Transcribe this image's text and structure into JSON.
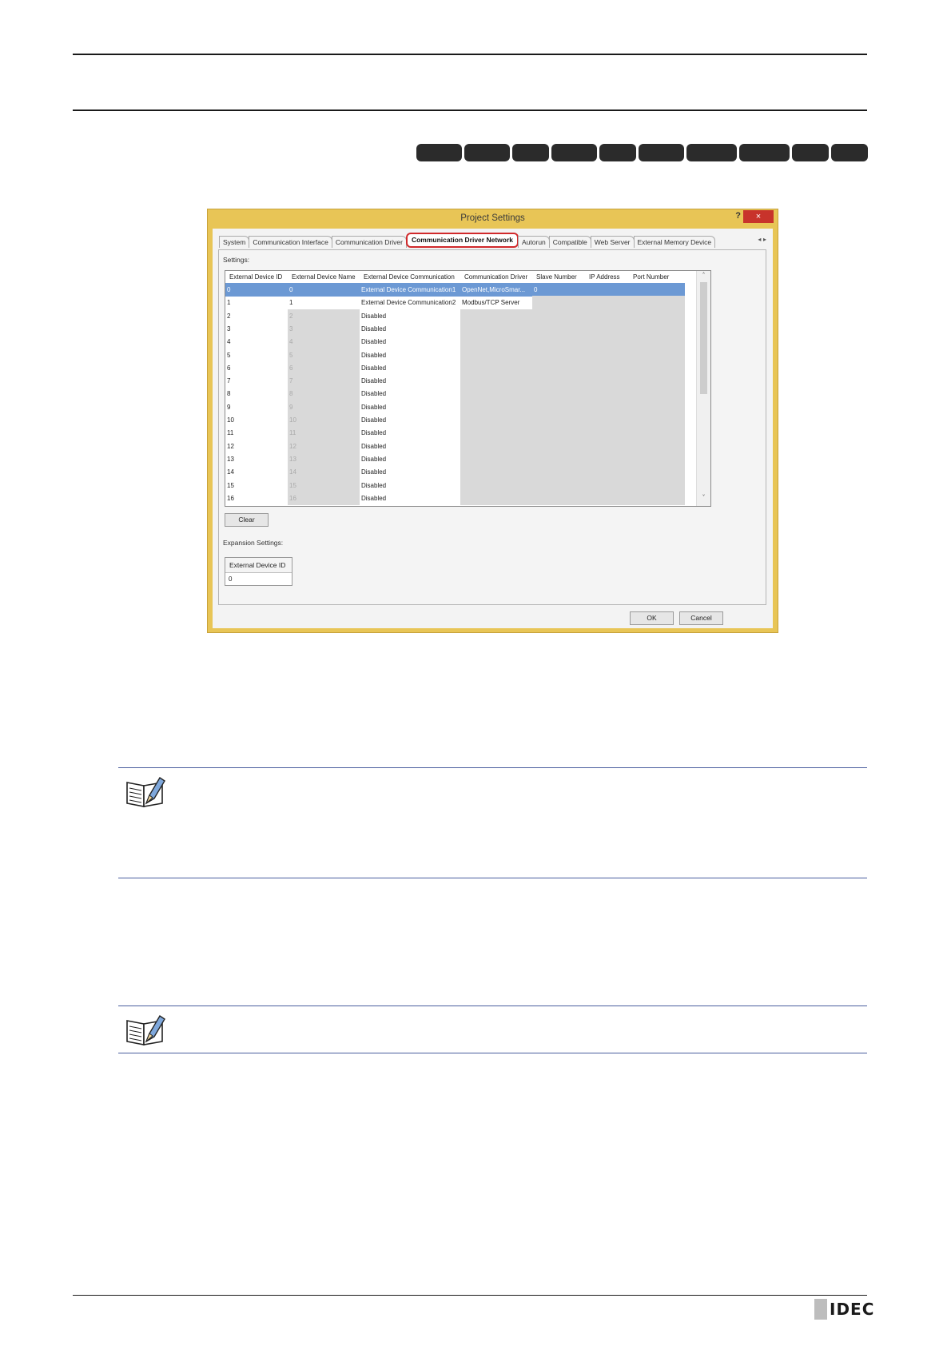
{
  "window": {
    "title": "Project Settings",
    "help_glyph": "?",
    "close_glyph": "×",
    "tabs": [
      "System",
      "Communication Interface",
      "Communication Driver",
      "Communication Driver Network",
      "Autorun",
      "Compatible",
      "Web Server",
      "External Memory Device"
    ],
    "active_tab": "Communication Driver Network",
    "tab_scroll_glyphs": "◂ ▸"
  },
  "settings": {
    "label": "Settings:",
    "columns": [
      "External Device ID",
      "External Device Name",
      "External Device Communication",
      "Communication Driver",
      "Slave Number",
      "IP Address",
      "Port Number"
    ],
    "rows": [
      {
        "id": "0",
        "name": "0",
        "comm": "External Device Communication1",
        "driver": "OpenNet,MicroSmar...",
        "slave": "0"
      },
      {
        "id": "1",
        "name": "1",
        "comm": "External Device Communication2",
        "driver": "Modbus/TCP Server",
        "slave": ""
      },
      {
        "id": "2",
        "name": "2",
        "comm": "Disabled",
        "driver": "",
        "slave": ""
      },
      {
        "id": "3",
        "name": "3",
        "comm": "Disabled",
        "driver": "",
        "slave": ""
      },
      {
        "id": "4",
        "name": "4",
        "comm": "Disabled",
        "driver": "",
        "slave": ""
      },
      {
        "id": "5",
        "name": "5",
        "comm": "Disabled",
        "driver": "",
        "slave": ""
      },
      {
        "id": "6",
        "name": "6",
        "comm": "Disabled",
        "driver": "",
        "slave": ""
      },
      {
        "id": "7",
        "name": "7",
        "comm": "Disabled",
        "driver": "",
        "slave": ""
      },
      {
        "id": "8",
        "name": "8",
        "comm": "Disabled",
        "driver": "",
        "slave": ""
      },
      {
        "id": "9",
        "name": "9",
        "comm": "Disabled",
        "driver": "",
        "slave": ""
      },
      {
        "id": "10",
        "name": "10",
        "comm": "Disabled",
        "driver": "",
        "slave": ""
      },
      {
        "id": "11",
        "name": "11",
        "comm": "Disabled",
        "driver": "",
        "slave": ""
      },
      {
        "id": "12",
        "name": "12",
        "comm": "Disabled",
        "driver": "",
        "slave": ""
      },
      {
        "id": "13",
        "name": "13",
        "comm": "Disabled",
        "driver": "",
        "slave": ""
      },
      {
        "id": "14",
        "name": "14",
        "comm": "Disabled",
        "driver": "",
        "slave": ""
      },
      {
        "id": "15",
        "name": "15",
        "comm": "Disabled",
        "driver": "",
        "slave": ""
      },
      {
        "id": "16",
        "name": "16",
        "comm": "Disabled",
        "driver": "",
        "slave": ""
      }
    ],
    "scroll_up": "˄",
    "scroll_down": "˅"
  },
  "clear_button": "Clear",
  "expansion": {
    "label": "Expansion Settings:",
    "header": "External Device ID",
    "value": "0"
  },
  "buttons": {
    "ok": "OK",
    "cancel": "Cancel"
  },
  "logo": "IDEC"
}
